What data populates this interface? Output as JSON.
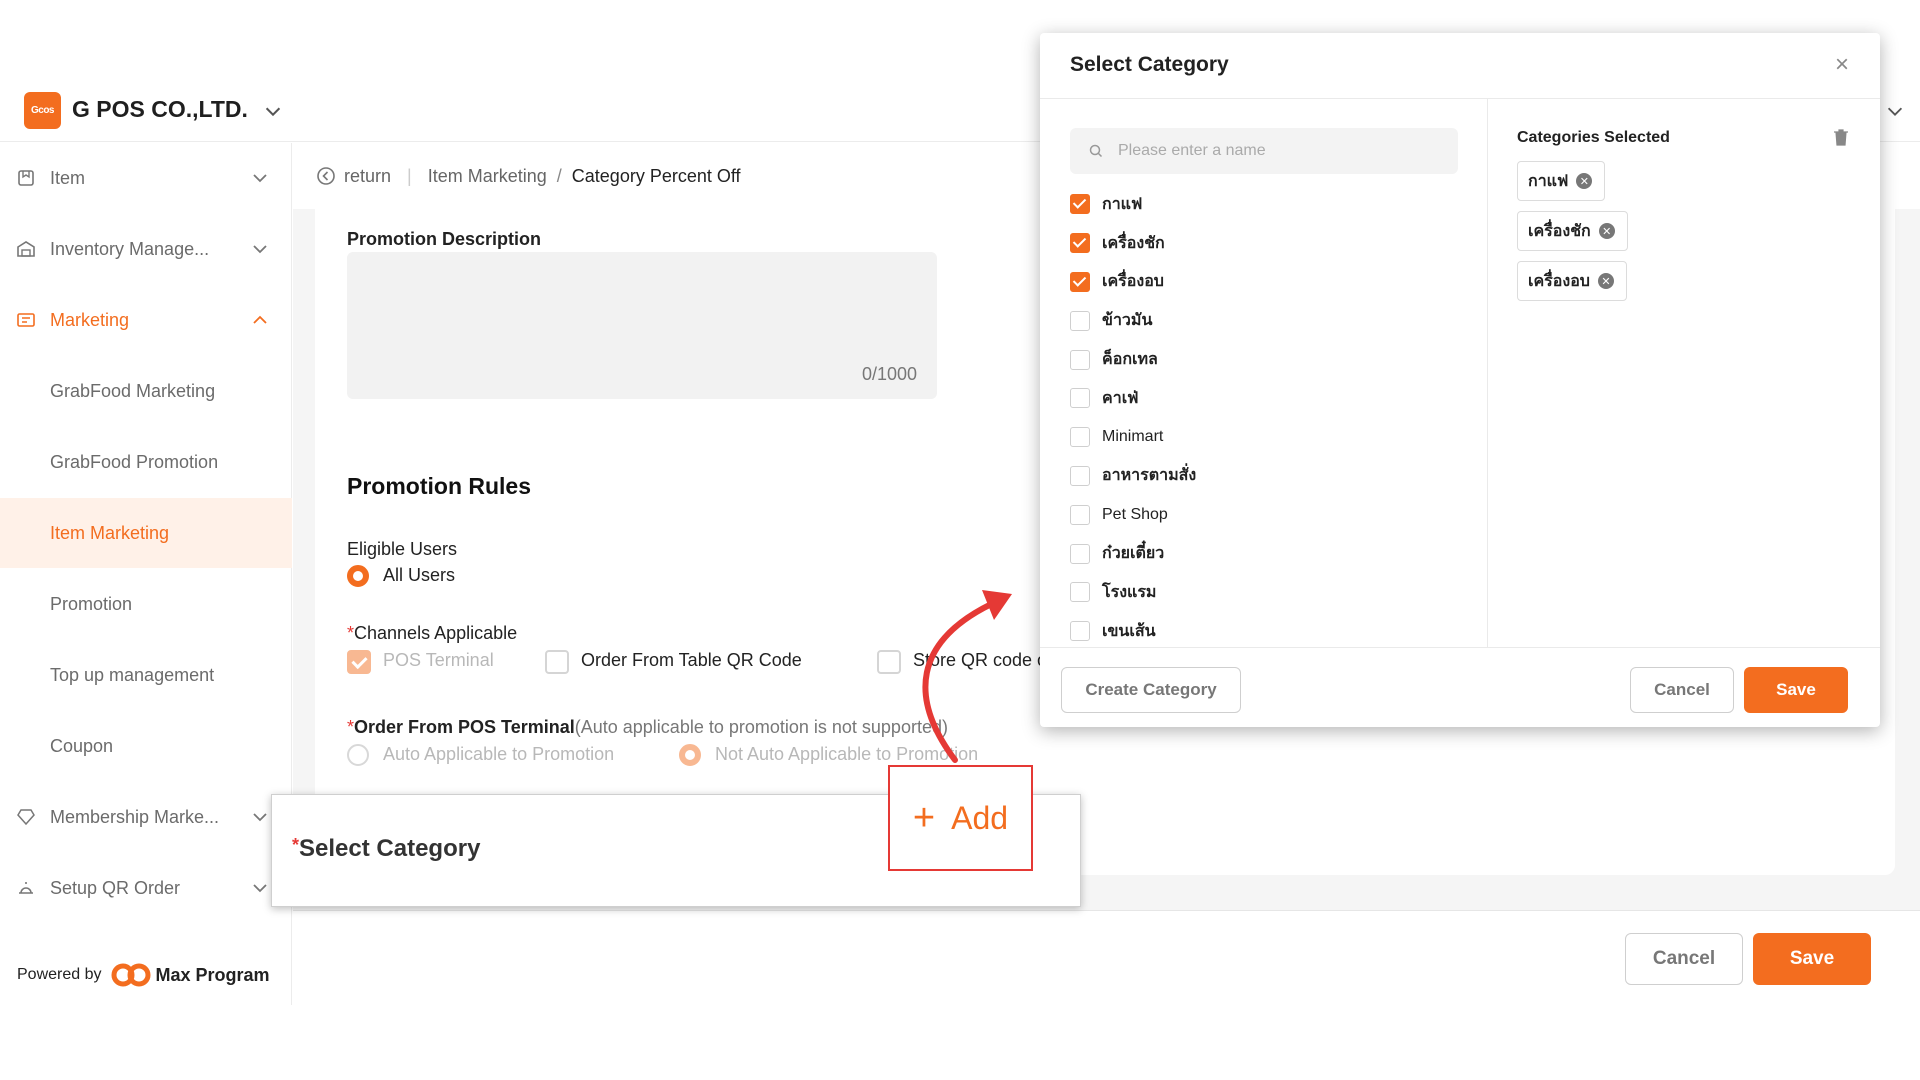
{
  "header": {
    "logo_text": "Gcos",
    "company": "G POS CO.,LTD."
  },
  "sidebar": {
    "items": [
      {
        "label": "Item",
        "icon": "bookmark-icon"
      },
      {
        "label": "Inventory Manage...",
        "icon": "warehouse-icon"
      },
      {
        "label": "Marketing",
        "icon": "marketing-icon"
      },
      {
        "label": "GrabFood Marketing"
      },
      {
        "label": "GrabFood Promotion"
      },
      {
        "label": "Item Marketing"
      },
      {
        "label": "Promotion"
      },
      {
        "label": "Top up management"
      },
      {
        "label": "Coupon"
      },
      {
        "label": "Membership Marke...",
        "icon": "gem-icon"
      },
      {
        "label": "Setup QR Order",
        "icon": "bell-icon"
      }
    ],
    "powered_by": "Powered by",
    "brand": "Max Program"
  },
  "breadcrumb": {
    "return": "return",
    "parent": "Item Marketing",
    "sep": "/",
    "current": "Category Percent Off"
  },
  "form": {
    "promo_desc_label": "Promotion Description",
    "promo_desc_count": "0/1000",
    "rules_title": "Promotion Rules",
    "eligible_users_label": "Eligible Users",
    "all_users": "All Users",
    "channels_label": "Channels Applicable",
    "required_mark": "*",
    "channel_pos": "POS Terminal",
    "channel_table_qr": "Order From Table QR Code",
    "channel_store_qr": "Store QR code or",
    "order_pos_label": "Order From POS Terminal",
    "order_pos_note": "(Auto applicable to promotion is not supported)",
    "auto_applicable": "Auto Applicable to Promotion",
    "not_auto_applicable": "Not Auto Applicable to Promotion",
    "cancel": "Cancel",
    "save": "Save"
  },
  "callout": {
    "select_category": "Select Category",
    "add": "Add",
    "plus": "+"
  },
  "modal": {
    "title": "Select Category",
    "close": "×",
    "search_placeholder": "Please enter a name",
    "categories": [
      {
        "label": "กาแฟ",
        "checked": true
      },
      {
        "label": "เครื่องชัก",
        "checked": true
      },
      {
        "label": "เครื่องอบ",
        "checked": true
      },
      {
        "label": "ข้าวมัน",
        "checked": false
      },
      {
        "label": "ค็อกเทล",
        "checked": false
      },
      {
        "label": "คาเฟ่",
        "checked": false
      },
      {
        "label": "Minimart",
        "checked": false
      },
      {
        "label": "อาหารตามสั่ง",
        "checked": false
      },
      {
        "label": "Pet Shop",
        "checked": false
      },
      {
        "label": "ก๋วยเตี๋ยว",
        "checked": false
      },
      {
        "label": "โรงแรม",
        "checked": false
      },
      {
        "label": "เขนเส้น",
        "checked": false
      }
    ],
    "selected_title": "Categories Selected",
    "selected": [
      "กาแฟ",
      "เครื่องชัก",
      "เครื่องอบ"
    ],
    "create_category": "Create Category",
    "cancel": "Cancel",
    "save": "Save"
  },
  "colors": {
    "accent": "#f36d1f",
    "highlight_border": "#e53935"
  }
}
